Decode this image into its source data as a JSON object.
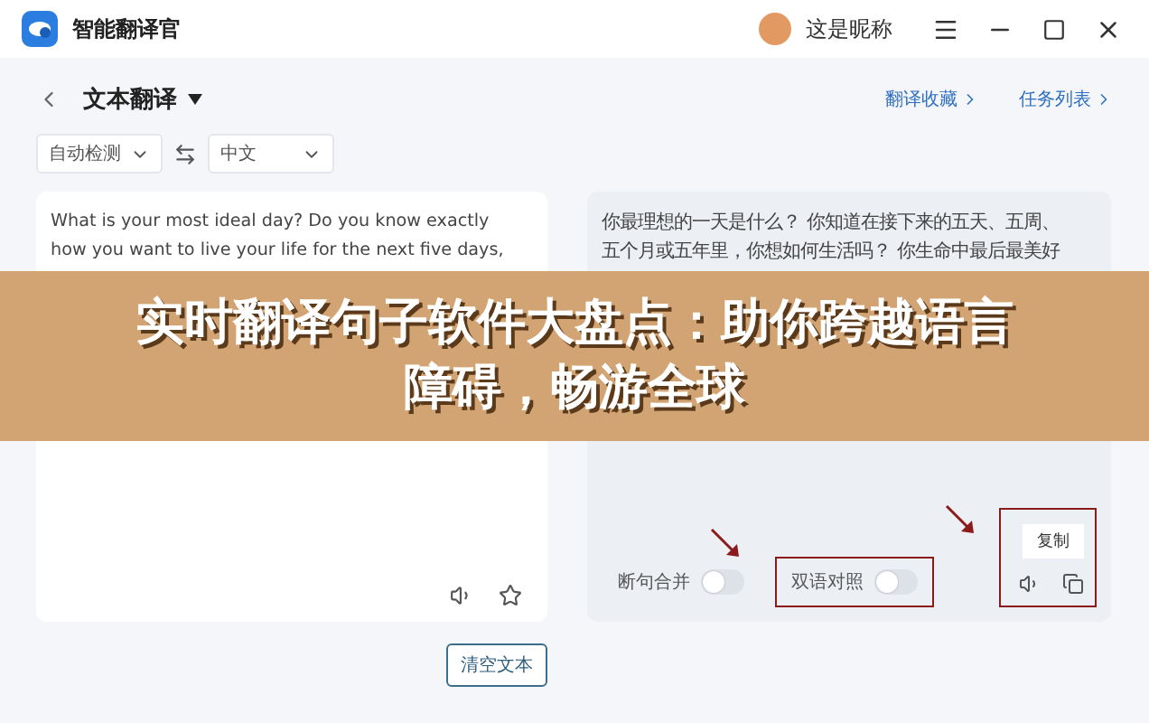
{
  "window": {
    "title": "智能翻译官",
    "user": "这是昵称"
  },
  "header": {
    "mode": "文本翻译",
    "links": [
      "翻译收藏",
      "任务列表"
    ]
  },
  "languages": {
    "source": "自动检测",
    "target": "中文"
  },
  "source_panel": {
    "lines": [
      {
        "text": "What is your most ideal day? Do you know exactly"
      },
      {
        "text": "how you want to live your life for the next five days,"
      }
    ]
  },
  "target_panel": {
    "lines": [
      {
        "text": "你最理想的一天是什么？ 你知道在接下来的五天、五周、"
      },
      {
        "text": "五个月或五年里，你想如何生活吗？ 你生命中最后最美好"
      }
    ],
    "toggles": [
      {
        "label": "断句合并",
        "on": false,
        "highlighted": false
      },
      {
        "label": "双语对照",
        "on": false,
        "highlighted": true
      }
    ],
    "tooltip": "复制"
  },
  "clear_button": "清空文本",
  "banner": {
    "lines": [
      "实时翻译句子软件大盘点：助你跨越语言",
      "障碍，畅游全球"
    ]
  }
}
